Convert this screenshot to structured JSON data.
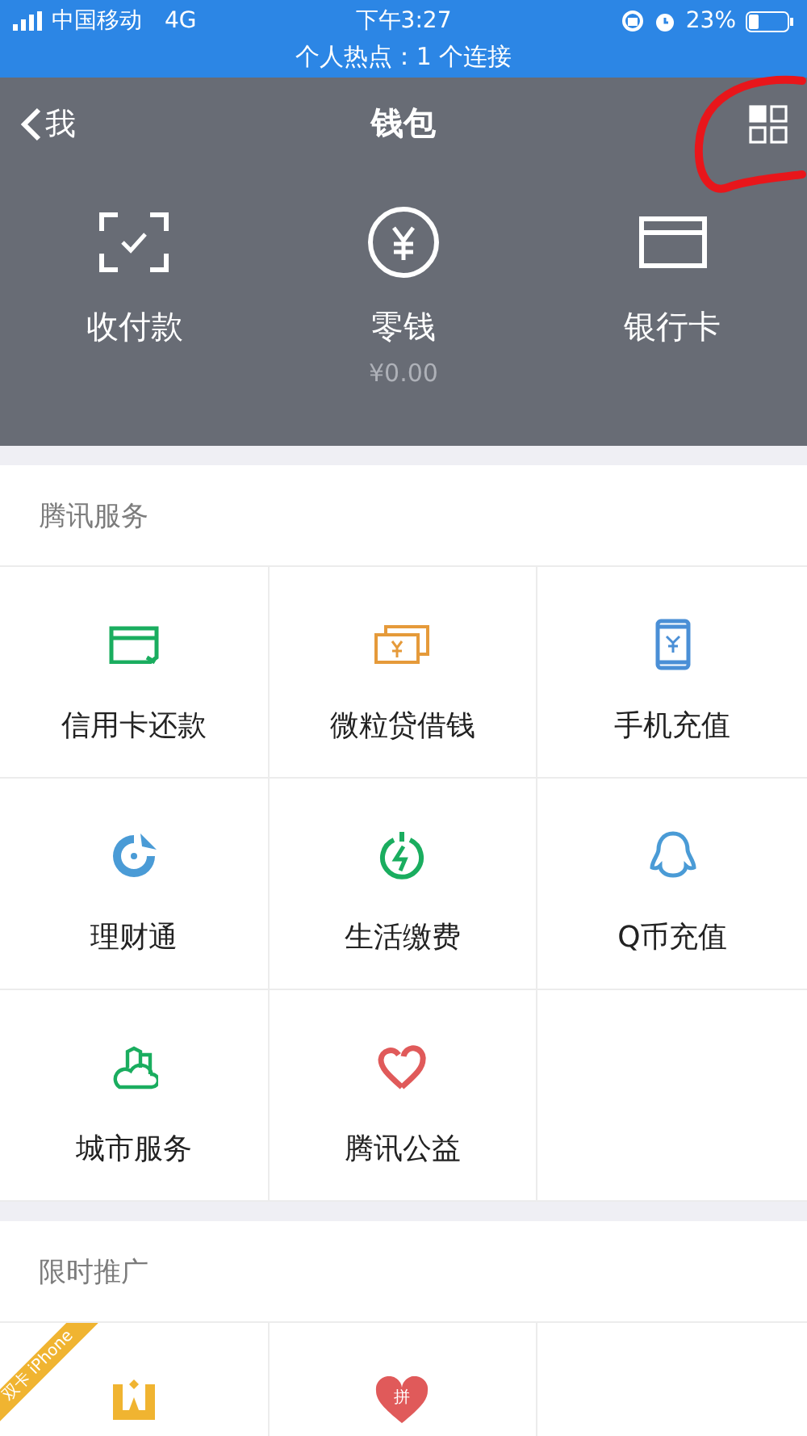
{
  "status_bar": {
    "carrier": "中国移动",
    "network": "4G",
    "time": "下午3:27",
    "battery": "23%",
    "hotspot": "个人热点：1 个连接"
  },
  "nav": {
    "back": "我",
    "title": "钱包"
  },
  "actions": [
    {
      "label": "收付款",
      "kind": "scan"
    },
    {
      "label": "零钱",
      "kind": "yuan",
      "amount": "¥0.00"
    },
    {
      "label": "银行卡",
      "kind": "card"
    }
  ],
  "sections": [
    {
      "title": "腾讯服务",
      "items": [
        {
          "label": "信用卡还款",
          "kind": "credit"
        },
        {
          "label": "微粒贷借钱",
          "kind": "bills"
        },
        {
          "label": "手机充值",
          "kind": "phone"
        },
        {
          "label": "理财通",
          "kind": "fish"
        },
        {
          "label": "生活缴费",
          "kind": "power"
        },
        {
          "label": "Q币充值",
          "kind": "penguin"
        },
        {
          "label": "城市服务",
          "kind": "city"
        },
        {
          "label": "腾讯公益",
          "kind": "heart"
        }
      ]
    },
    {
      "title": "限时推广",
      "items": [
        {
          "kind": "crown",
          "badge": "双卡 iPhone"
        },
        {
          "kind": "pin",
          "icon_text": "拼"
        }
      ]
    }
  ]
}
